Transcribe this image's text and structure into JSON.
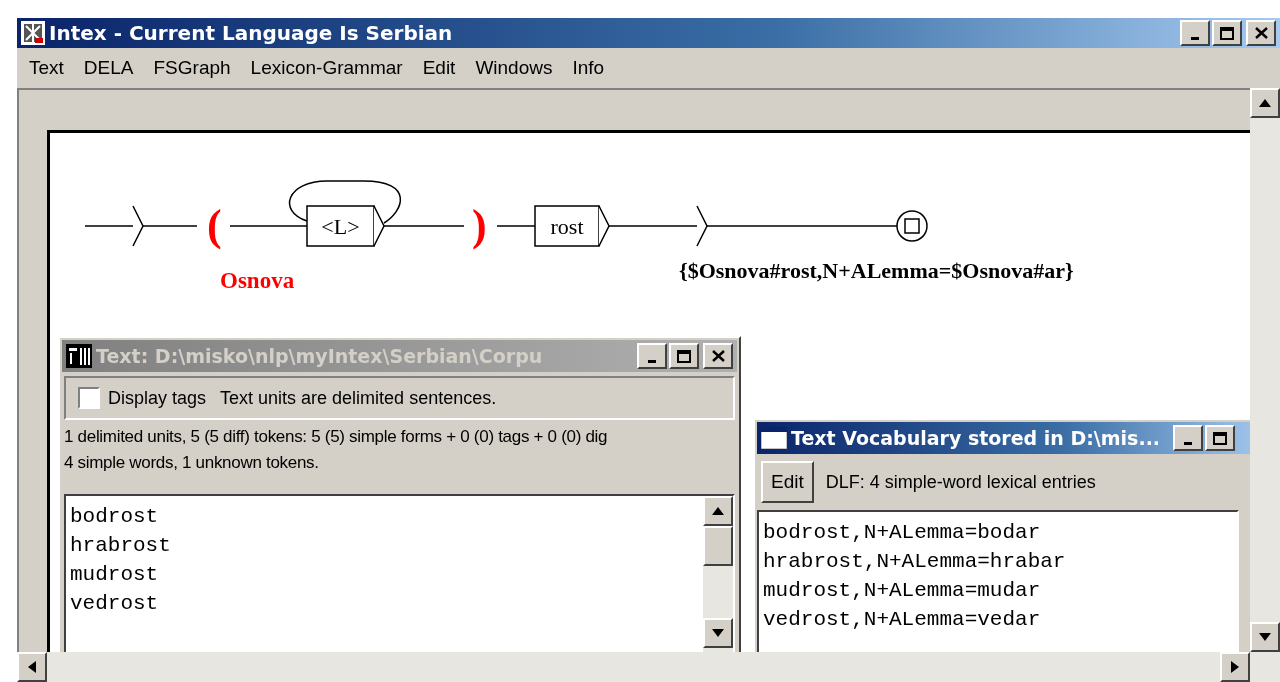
{
  "window": {
    "title": "Intex - Current Language Is Serbian",
    "active": true
  },
  "menu": [
    {
      "label": "Text"
    },
    {
      "label": "DELA"
    },
    {
      "label": "FSGraph"
    },
    {
      "label": "Lexicon-Grammar"
    },
    {
      "label": "Edit"
    },
    {
      "label": "Windows"
    },
    {
      "label": "Info"
    }
  ],
  "graph": {
    "nodes": [
      {
        "kind": "initial"
      },
      {
        "kind": "open",
        "label": "(",
        "variable": "Osnova"
      },
      {
        "kind": "box",
        "label": "<L>",
        "loop": true
      },
      {
        "kind": "close",
        "label": ")"
      },
      {
        "kind": "box",
        "label": "rost",
        "loop": false
      },
      {
        "kind": "arrow",
        "output": "{$Osnova#rost,N+ALemma=$Osnova#ar}"
      },
      {
        "kind": "final"
      }
    ]
  },
  "text_window": {
    "title": "Text: D:\\misko\\nlp\\myIntex\\Serbian\\Corpu",
    "active": false,
    "display_tags": {
      "label": "Display tags",
      "checked": false
    },
    "units_note": "Text units are delimited sentences.",
    "stats": [
      "1 delimited units, 5 (5 diff) tokens: 5 (5) simple forms + 0 (0) tags + 0 (0) dig",
      "4 simple words, 1 unknown tokens."
    ],
    "words": [
      "bodrost",
      "hrabrost",
      "mudrost",
      "vedrost"
    ]
  },
  "vocabulary_window": {
    "title": "Text Vocabulary stored in D:\\mis...",
    "active": true,
    "edit_button": "Edit",
    "summary": "DLF: 4 simple-word lexical entries",
    "entries": [
      "bodrost,N+ALemma=bodar",
      "hrabrost,N+ALemma=hrabar",
      "mudrost,N+ALemma=mudar",
      "vedrost,N+ALemma=vedar"
    ]
  }
}
